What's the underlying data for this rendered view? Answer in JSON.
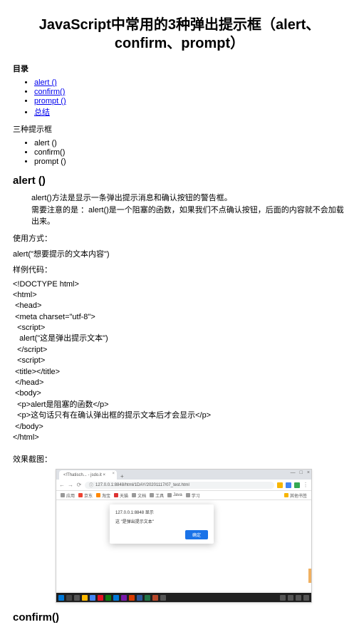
{
  "title": "JavaScript中常用的3种弹出提示框（alert、confirm、prompt）",
  "toc": {
    "heading": "目录",
    "items": [
      "alert ()",
      "confirm()",
      "prompt ()",
      "总结"
    ]
  },
  "threebox": {
    "heading": "三种提示框",
    "items": [
      "alert ()",
      "confirm()",
      "prompt ()"
    ]
  },
  "alert": {
    "heading": "alert ()",
    "desc1": "alert()方法是显示一条弹出提示消息和确认按钮的警告框。",
    "desc2": "需要注意的是 ：alert()是一个阻塞的函数，如果我们不点确认按钮，后面的内容就不会加载出来。",
    "usage_label": "使用方式：",
    "usage_code": "alert(\"想要提示的文本内容\")",
    "sample_label": "样例代码：",
    "code_lines": [
      "<!DOCTYPE html>",
      "<html>",
      " <head>",
      " <meta charset=\"utf-8\">",
      "  <script>",
      "   alert(\"这是弹出提示文本\")",
      "  </script>",
      "  <script>",
      " <title></title>",
      " </head>",
      " <body>",
      "  <p>alert是阻塞的函数</p>",
      "  <p>这句话只有在确认弹出框的提示文本后才会显示</p>",
      " </body>",
      "</html>"
    ],
    "shot_label": "效果截图："
  },
  "browser": {
    "tab_title": "<!Thatisch... - jsdo.it ×",
    "url": "127.0.0.1:8848/html/1DAY/20201117/07_test.html",
    "bookmarks": [
      "应用",
      "京东",
      "淘宝",
      "天猫",
      "文档",
      "工具",
      "Java",
      "学习"
    ],
    "right_bm": "其他书签",
    "dialog_origin": "127.0.0.1:8848 显示",
    "dialog_msg": "这 \"是弹出提示文本\"",
    "dialog_ok": "确定"
  },
  "confirm_heading": "confirm()"
}
